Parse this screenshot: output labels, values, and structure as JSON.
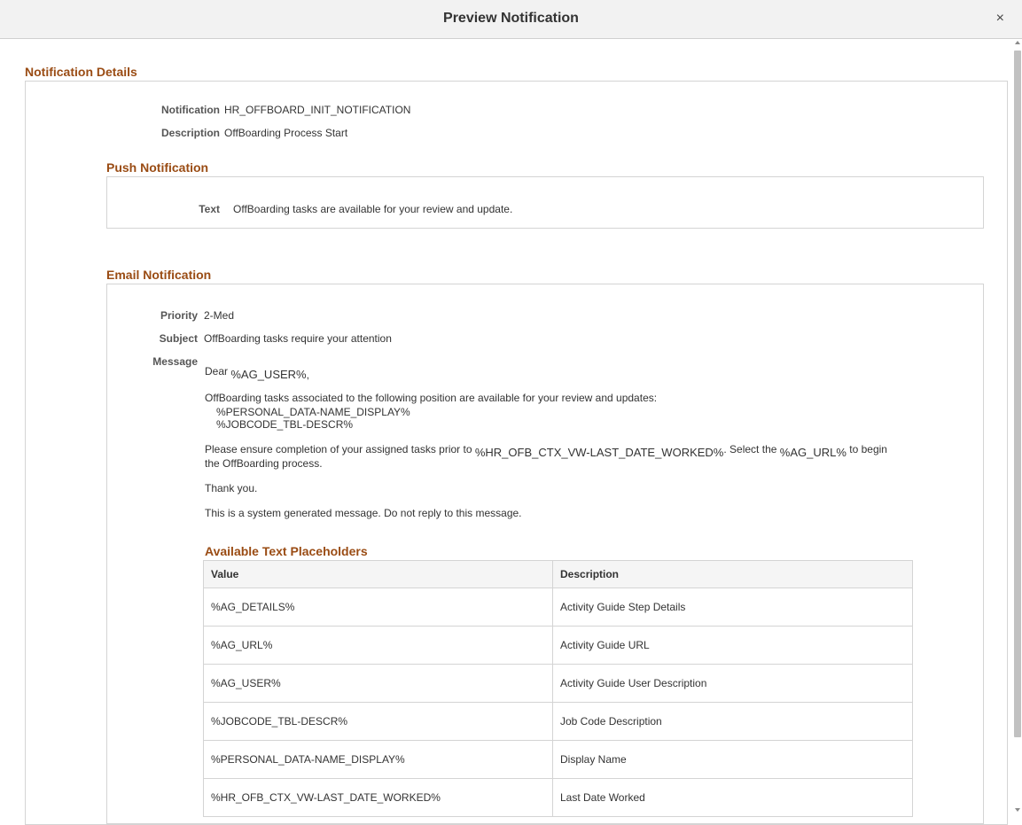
{
  "dialog": {
    "title": "Preview Notification",
    "close_glyph": "×"
  },
  "notification_details": {
    "heading": "Notification Details",
    "notification_label": "Notification",
    "notification_value": "HR_OFFBOARD_INIT_NOTIFICATION",
    "description_label": "Description",
    "description_value": "OffBoarding Process Start"
  },
  "push_notification": {
    "heading": "Push Notification",
    "text_label": "Text",
    "text_value": "OffBoarding tasks are available for your review and update."
  },
  "email_notification": {
    "heading": "Email Notification",
    "priority_label": "Priority",
    "priority_value": "2-Med",
    "subject_label": "Subject",
    "subject_value": "OffBoarding tasks require your attention",
    "message_label": "Message",
    "message": {
      "dear": "Dear",
      "user_token": "%AG_USER%",
      "comma": ",",
      "para1": "OffBoarding tasks associated to the following position are available for your review and updates:",
      "name_token": "%PERSONAL_DATA-NAME_DISPLAY%",
      "jobcode_token": "%JOBCODE_TBL-DESCR%",
      "para2_a": "Please ensure completion of your assigned tasks prior to",
      "date_token": "%HR_OFB_CTX_VW-LAST_DATE_WORKED%",
      "para2_b": ". Select the",
      "url_token": "%AG_URL%",
      "para2_c": "to begin",
      "para2_d": "the OffBoarding process.",
      "thanks": "Thank you.",
      "footer": "This is a system generated message.  Do not reply to this message."
    }
  },
  "placeholders": {
    "heading": "Available Text Placeholders",
    "col_value": "Value",
    "col_description": "Description",
    "rows": [
      {
        "value": "%AG_DETAILS%",
        "description": "Activity Guide Step Details"
      },
      {
        "value": "%AG_URL%",
        "description": "Activity Guide URL"
      },
      {
        "value": "%AG_USER%",
        "description": "Activity Guide User Description"
      },
      {
        "value": "%JOBCODE_TBL-DESCR%",
        "description": "Job Code Description"
      },
      {
        "value": "%PERSONAL_DATA-NAME_DISPLAY%",
        "description": "Display Name"
      },
      {
        "value": "%HR_OFB_CTX_VW-LAST_DATE_WORKED%",
        "description": "Last Date Worked"
      }
    ]
  },
  "colors": {
    "section_heading": "#9a4c14",
    "border": "#d4d4d4",
    "header_bg": "#f2f2f2"
  }
}
